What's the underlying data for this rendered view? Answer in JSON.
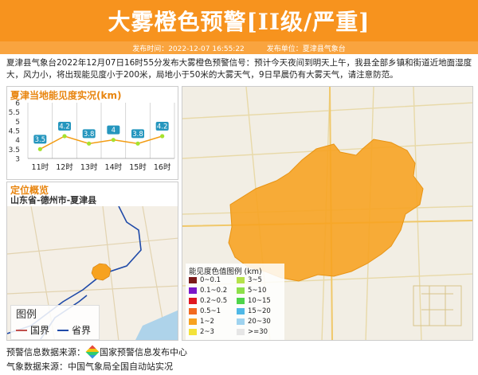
{
  "header": {
    "title": "大雾橙色预警[II级/严重]"
  },
  "subbar": {
    "time": "发布时间：2022-12-07 16:55:22",
    "unit": "发布单位：夏津县气象台"
  },
  "description": "夏津县气象台2022年12月07日16时55分发布大雾橙色预警信号：预计今天夜间到明天上午，我县全部乡镇和街道近地面湿度大，风力小，将出现能见度小于200米，局地小于50米的大雾天气，9日早晨仍有大雾天气，请注意防范。",
  "chart_data": {
    "type": "line",
    "title": "夏津当地能见度实况(km)",
    "categories": [
      "11时",
      "12时",
      "13时",
      "14时",
      "15时",
      "16时"
    ],
    "values": [
      3.5,
      4.2,
      3.8,
      4.0,
      3.8,
      4.2
    ],
    "value_labels": [
      "3.5",
      "4.2",
      "3.8",
      "4",
      "3.8",
      "4.2"
    ],
    "yticks": [
      "3",
      "3.5",
      "4",
      "4.5",
      "5",
      "5.5",
      "6"
    ],
    "ylim": [
      3,
      6
    ],
    "line_color": "#f39c12",
    "point_color": "#a6e22e",
    "label_bg": "#2596be"
  },
  "locator": {
    "title": "定位概览",
    "region": "山东省-德州市-夏津县",
    "legend_title": "图例",
    "legend_items": [
      {
        "label": "国界",
        "color": "#c0504d"
      },
      {
        "label": "省界",
        "color": "#1f4aa8"
      }
    ]
  },
  "vis_legend": {
    "title": "能见度色值图例 (km)",
    "items": [
      {
        "label": "0~0.1",
        "color": "#7b1a1a"
      },
      {
        "label": "3~5",
        "color": "#b5e24a"
      },
      {
        "label": "0.1~0.2",
        "color": "#7a18c9"
      },
      {
        "label": "5~10",
        "color": "#8de04a"
      },
      {
        "label": "0.2~0.5",
        "color": "#e0181f"
      },
      {
        "label": "10~15",
        "color": "#4fd44a"
      },
      {
        "label": "0.5~1",
        "color": "#f26a1f"
      },
      {
        "label": "15~20",
        "color": "#4fb8e6"
      },
      {
        "label": "1~2",
        "color": "#f7a21f"
      },
      {
        "label": "20~30",
        "color": "#9fd3ef"
      },
      {
        "label": "2~3",
        "color": "#f3e23a"
      },
      {
        "label": ">=30",
        "color": "#e6e6e6"
      }
    ]
  },
  "footer": {
    "source1": "预警信息数据来源：",
    "source1_name": "国家预警信息发布中心",
    "source2": "气象数据来源：中国气象局全国自动站实况"
  }
}
